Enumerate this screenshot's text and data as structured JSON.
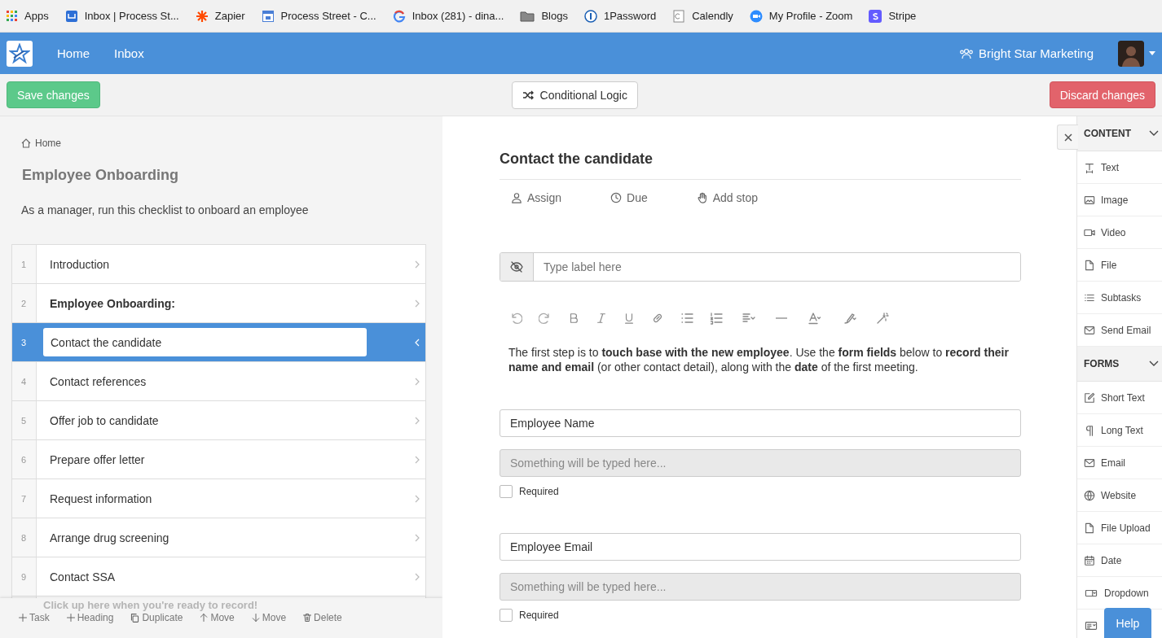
{
  "bookmarks": [
    {
      "label": "Apps",
      "kind": "grid"
    },
    {
      "label": "Inbox | Process St...",
      "kind": "inbox"
    },
    {
      "label": "Zapier",
      "kind": "star"
    },
    {
      "label": "Process Street - C...",
      "kind": "calendar"
    },
    {
      "label": "Inbox (281) - dina...",
      "kind": "google"
    },
    {
      "label": "Blogs",
      "kind": "folder"
    },
    {
      "label": "1Password",
      "kind": "key"
    },
    {
      "label": "Calendly",
      "kind": "page"
    },
    {
      "label": "My Profile - Zoom",
      "kind": "camera"
    },
    {
      "label": "Stripe",
      "kind": "stripe"
    }
  ],
  "nav": {
    "items": [
      {
        "label": "Home"
      },
      {
        "label": "Inbox"
      }
    ],
    "org": "Bright Star Marketing"
  },
  "actions": {
    "save": "Save changes",
    "logic": "Conditional Logic",
    "discard": "Discard changes"
  },
  "checklist": {
    "breadcrumb": "Home",
    "title": "Employee Onboarding",
    "description": "As a manager, run this checklist to onboard an employee",
    "tasks": [
      {
        "number": "1",
        "label": "Introduction",
        "kind": "task",
        "selected": false
      },
      {
        "number": "2",
        "label": "Employee Onboarding:",
        "kind": "heading",
        "selected": false
      },
      {
        "number": "3",
        "label": "Contact the candidate",
        "kind": "task",
        "selected": true
      },
      {
        "number": "4",
        "label": "Contact references",
        "kind": "task",
        "selected": false
      },
      {
        "number": "5",
        "label": "Offer job to candidate",
        "kind": "task",
        "selected": false
      },
      {
        "number": "6",
        "label": "Prepare offer letter",
        "kind": "task",
        "selected": false
      },
      {
        "number": "7",
        "label": "Request information",
        "kind": "task",
        "selected": false
      },
      {
        "number": "8",
        "label": "Arrange drug screening",
        "kind": "task",
        "selected": false
      },
      {
        "number": "9",
        "label": "Contact SSA",
        "kind": "task",
        "selected": false
      }
    ]
  },
  "toolbar": {
    "tip": "Click up here when you're ready to record!",
    "buttons": [
      {
        "kind": "add",
        "label": "Task"
      },
      {
        "kind": "add",
        "label": "Heading"
      },
      {
        "kind": "copy",
        "label": "Duplicate"
      },
      {
        "kind": "up",
        "label": "Move"
      },
      {
        "kind": "down",
        "label": "Move"
      },
      {
        "kind": "trash",
        "label": "Delete"
      }
    ]
  },
  "editor": {
    "title": "Contact the candidate",
    "meta": [
      {
        "kind": "user",
        "label": "Assign"
      },
      {
        "kind": "clock",
        "label": "Due"
      },
      {
        "kind": "hand",
        "label": "Add stop"
      }
    ],
    "label_placeholder": "Type label here",
    "body": "The first step is to **touch base with the new employee**. Use the **form fields** below to **record their name and email** (or other contact detail), along with the **date** of the first meeting.",
    "fields": [
      {
        "label": "Employee Name",
        "placeholder": "Something will be typed here...",
        "required_label": "Required",
        "required": false
      },
      {
        "label": "Employee Email",
        "placeholder": "Something will be typed here...",
        "required_label": "Required",
        "required": false
      }
    ]
  },
  "widgets": {
    "sections": [
      {
        "title": "CONTENT",
        "expanded": true,
        "items": [
          {
            "kind": "text",
            "label": "Text"
          },
          {
            "kind": "image",
            "label": "Image"
          },
          {
            "kind": "video",
            "label": "Video"
          },
          {
            "kind": "file",
            "label": "File"
          },
          {
            "kind": "list",
            "label": "Subtasks"
          },
          {
            "kind": "mail",
            "label": "Send Email"
          }
        ]
      },
      {
        "title": "FORMS",
        "expanded": true,
        "items": [
          {
            "kind": "edit",
            "label": "Short Text"
          },
          {
            "kind": "para",
            "label": "Long Text"
          },
          {
            "kind": "mail",
            "label": "Email"
          },
          {
            "kind": "globe",
            "label": "Website"
          },
          {
            "kind": "file",
            "label": "File Upload"
          },
          {
            "kind": "date",
            "label": "Date"
          },
          {
            "kind": "dropdown",
            "label": "Dropdown"
          },
          {
            "kind": "multi"
          }
        ]
      }
    ]
  },
  "help": "Help"
}
